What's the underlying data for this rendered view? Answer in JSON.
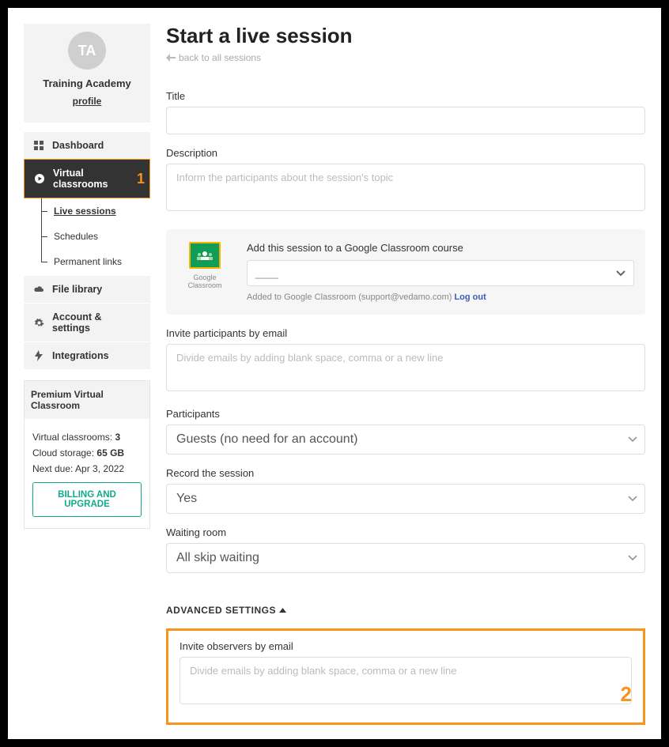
{
  "profile": {
    "avatar_initials": "TA",
    "name": "Training Academy",
    "profile_link_label": "profile"
  },
  "nav": {
    "dashboard": "Dashboard",
    "virtual_classrooms": "Virtual classrooms",
    "sub": {
      "live_sessions": "Live sessions",
      "schedules": "Schedules",
      "permanent_links": "Permanent links"
    },
    "file_library": "File library",
    "account_settings": "Account & settings",
    "integrations": "Integrations"
  },
  "premium": {
    "heading": "Premium Virtual Classroom",
    "line1_label": "Virtual classrooms:",
    "line1_value": "3",
    "line2_label": "Cloud storage:",
    "line2_value": "65 GB",
    "line3_label": "Next due:",
    "line3_value": "Apr 3, 2022",
    "button": "BILLING AND UPGRADE"
  },
  "page": {
    "title": "Start a live session",
    "back_label": "back to all sessions"
  },
  "form": {
    "title_label": "Title",
    "description_label": "Description",
    "description_placeholder": "Inform the participants about the session's topic",
    "gc": {
      "logo_caption": "Google Classroom",
      "heading": "Add this session to a Google Classroom course",
      "selected": "____",
      "note_prefix": "Added to Google Classroom (support@vedamo.com) ",
      "logout_label": "Log out"
    },
    "invite_label": "Invite participants by email",
    "invite_placeholder": "Divide emails by adding blank space, comma or a new line",
    "participants_label": "Participants",
    "participants_value": "Guests (no need for an account)",
    "record_label": "Record the session",
    "record_value": "Yes",
    "waiting_label": "Waiting room",
    "waiting_value": "All skip waiting",
    "advanced_label": "ADVANCED SETTINGS",
    "observers_label": "Invite observers by email",
    "observers_placeholder": "Divide emails by adding blank space, comma or a new line"
  },
  "annotations": {
    "one": "1",
    "two": "2"
  }
}
